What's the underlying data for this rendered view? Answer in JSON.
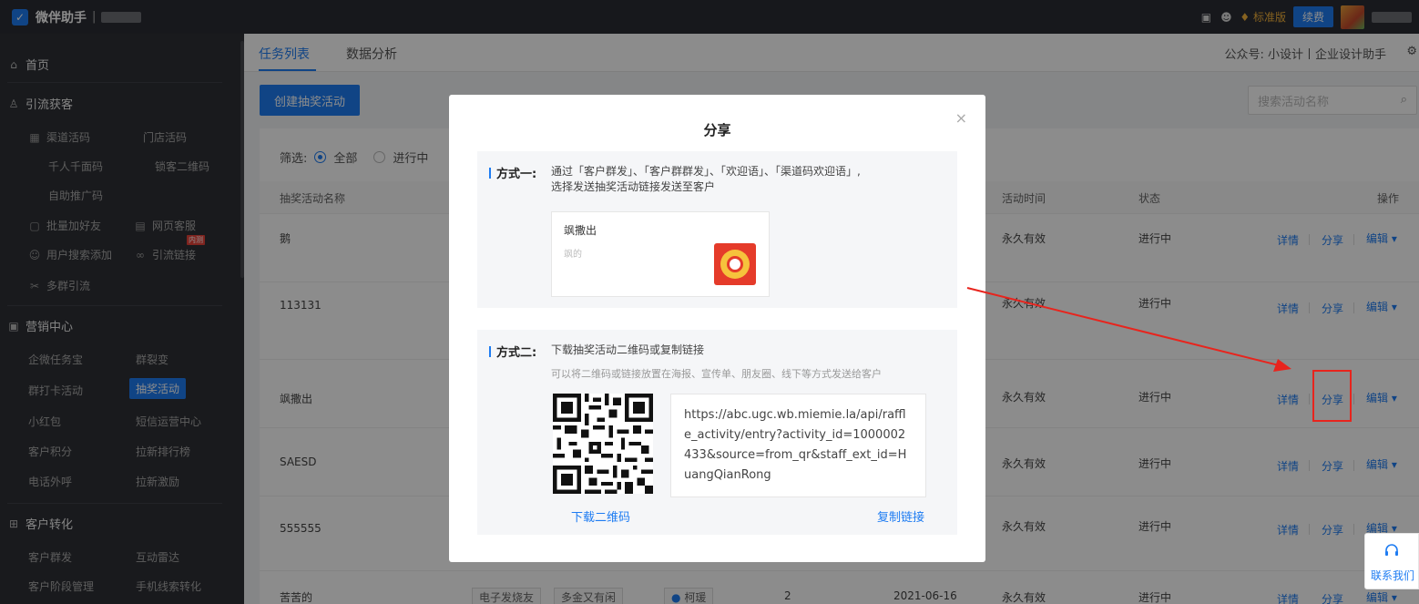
{
  "topbar": {
    "app_title": "微伴助手",
    "separator": "|",
    "edition": "标准版",
    "renew_label": "续费"
  },
  "sidebar": {
    "home": "首页",
    "acquire": {
      "title": "引流获客",
      "items": [
        "渠道活码",
        "门店活码",
        "千人千面码",
        "锁客二维码",
        "自助推广码",
        "批量加好友",
        "网页客服",
        "用户搜索添加",
        "引流链接",
        "多群引流"
      ],
      "tag": "内测"
    },
    "marketing": {
      "title": "营销中心",
      "items": [
        "企微任务宝",
        "群裂变",
        "群打卡活动",
        "抽奖活动",
        "小红包",
        "短信运营中心",
        "客户积分",
        "拉新排行榜",
        "电话外呼",
        "拉新激励"
      ]
    },
    "conversion": {
      "title": "客户转化",
      "items": [
        "客户群发",
        "互动雷达",
        "客户阶段管理",
        "手机线索转化"
      ]
    }
  },
  "tabs": {
    "task_list": "任务列表",
    "data_analysis": "数据分析",
    "gzh_prefix": "公众号:",
    "gzh_name": "小设计丨企业设计助手"
  },
  "toolbar": {
    "create_label": "创建抽奖活动",
    "search_placeholder": "搜索活动名称"
  },
  "filter": {
    "label": "筛选:",
    "all": "全部",
    "ongoing": "进行中"
  },
  "table": {
    "headers": {
      "name": "抽奖活动名称",
      "time": "活动时间",
      "status": "状态",
      "ops": "操作"
    },
    "rows": [
      {
        "name": "鹅",
        "time": "永久有效",
        "status": "进行中"
      },
      {
        "name": "113131",
        "time": "永久有效",
        "status": "进行中"
      },
      {
        "name": "飒撒出",
        "time": "永久有效",
        "status": "进行中"
      },
      {
        "name": "SAESD",
        "time": "永久有效",
        "status": "进行中"
      },
      {
        "name": "555555",
        "time": "永久有效",
        "status": "进行中"
      },
      {
        "name": "苦苦的",
        "tag1": "电子发烧友",
        "tag2": "多金又有闲",
        "staff": "柯瑗",
        "count": "2",
        "date": "2021-06-16",
        "time": "永久有效",
        "status": "进行中"
      }
    ],
    "op_detail": "详情",
    "op_share": "分享",
    "op_edit": "编辑"
  },
  "modal": {
    "title": "分享",
    "close": "×",
    "method1": {
      "label": "方式一:",
      "text_line1": "通过「客户群发」、「客户群群发」、「欢迎语」、「渠道码欢迎语」,",
      "text_line2": "选择发送抽奖活动链接发送至客户",
      "card_title": "飒撒出",
      "card_sub": "飒的"
    },
    "method2": {
      "label": "方式二:",
      "text": "下载抽奖活动二维码或复制链接",
      "sub": "可以将二维码或链接放置在海报、宣传单、朋友圈、线下等方式发送给客户",
      "link": "https://abc.ugc.wb.miemie.la/api/raffle_activity/entry?activity_id=1000002433&source=from_qr&staff_ext_id=HuangQianRong",
      "download_label": "下载二维码",
      "copy_label": "复制链接"
    }
  },
  "contact": {
    "label": "联系我们"
  },
  "colors": {
    "primary": "#1e7cf2",
    "topbar": "#2b2d33",
    "sidebar": "#2f3136",
    "annotation_red": "#e8241d"
  }
}
